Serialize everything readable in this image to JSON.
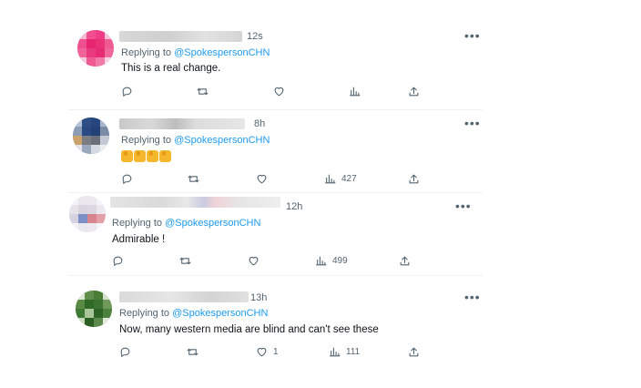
{
  "tweets": [
    {
      "time": "12s",
      "replying_prefix": "Replying to ",
      "handle": "@SpokespersonCHN",
      "text": "This is a real change.",
      "views": "",
      "likes": ""
    },
    {
      "time": "8h",
      "replying_prefix": "Replying to ",
      "handle": "@SpokespersonCHN",
      "text": "",
      "emoji": "thumbs-up x4",
      "views": "427",
      "likes": ""
    },
    {
      "time": "12h",
      "replying_prefix": "Replying to ",
      "handle": "@SpokespersonCHN",
      "text": "Admirable !",
      "views": "499",
      "likes": ""
    },
    {
      "time": "13h",
      "replying_prefix": "Replying to ",
      "handle": "@SpokespersonCHN",
      "text": "Now, many western media are blind and can't see these",
      "views": "111",
      "likes": "1"
    }
  ],
  "icons": {
    "more": "more-horizontal-icon",
    "reply": "reply-icon",
    "retweet": "retweet-icon",
    "like": "heart-icon",
    "views": "analytics-icon",
    "share": "share-icon"
  },
  "colors": {
    "link": "#1d9bf0",
    "secondary": "#536471"
  }
}
